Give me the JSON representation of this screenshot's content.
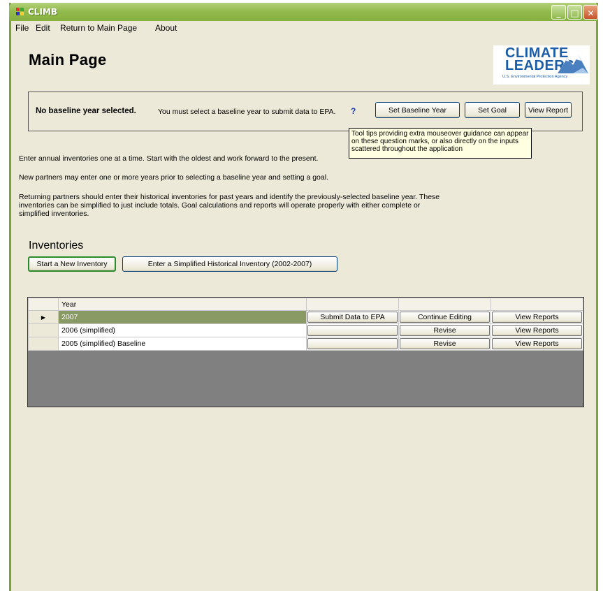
{
  "window": {
    "title": "CLIMB"
  },
  "titlebar_buttons": {
    "minimize": "_",
    "maximize": "□",
    "close": "✕"
  },
  "menu": [
    "File",
    "Edit",
    "Return to Main Page",
    "About"
  ],
  "page": {
    "title": "Main Page"
  },
  "logo": {
    "line1": "CLIMATE",
    "line2": "LEADERS",
    "line3": "U.S. Environmental Protection Agency"
  },
  "baseline": {
    "status": "No baseline year selected.",
    "message": "You must select a baseline year to submit data to EPA.",
    "help": "?",
    "set_baseline_label": "Set Baseline Year",
    "set_goal_label": "Set Goal",
    "view_report_label": "View Report"
  },
  "tooltip": {
    "text": "Tool tips providing extra mouseover guidance can appear on these question marks, or also directly on the inputs scattered throughout the application"
  },
  "instructions": {
    "p1": "Enter annual inventories one at a time. Start with the oldest and work forward to the present.",
    "p2": "New partners may enter one or more years prior to selecting a baseline year and setting a goal.",
    "p3": "Returning partners should enter their historical inventories for past years and identify the previously-selected baseline year. These inventories can be simplified to just include totals. Goal calculations and reports will operate properly with either complete or simplified inventories."
  },
  "inventories": {
    "heading": "Inventories",
    "new_button": "Start a New Inventory",
    "historical_button": "Enter a Simplified Historical Inventory (2002-2007)",
    "column_header": "Year",
    "row_pointer": "▶",
    "rows": [
      {
        "year": "2007",
        "submit": "Submit Data to EPA",
        "edit": "Continue Editing",
        "reports": "View Reports"
      },
      {
        "year": "2006 (simplified)",
        "submit": "",
        "edit": "Revise",
        "reports": "View Reports"
      },
      {
        "year": "2005 (simplified) Baseline",
        "submit": "",
        "edit": "Revise",
        "reports": "View Reports"
      }
    ]
  },
  "colors": {
    "titlebar": "#93bb4e",
    "selected_row": "#8a9a64",
    "grid_bg": "#808080",
    "help_mark": "#1a3bc8",
    "logo_blue": "#1c5da8"
  }
}
